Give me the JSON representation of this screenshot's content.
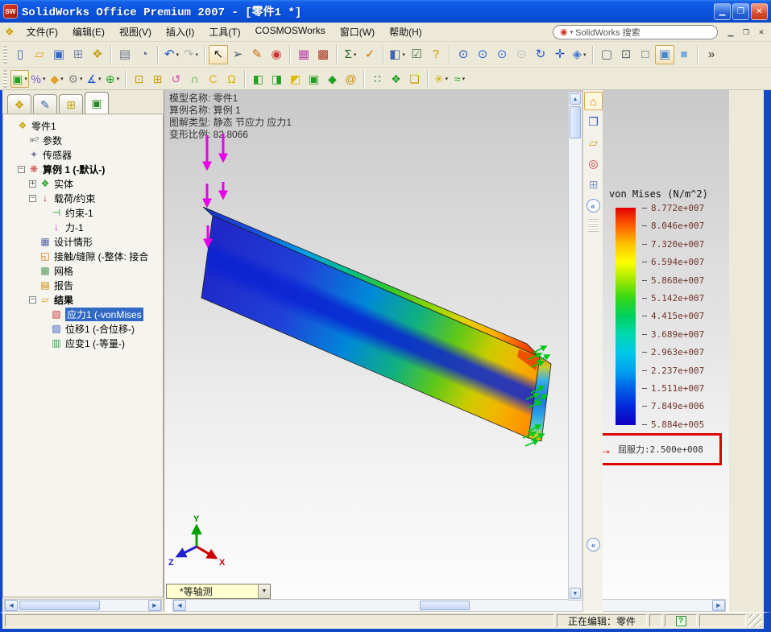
{
  "window": {
    "title": "SolidWorks Office Premium 2007 - [零件1 *]",
    "app_icon": "SW",
    "controls": [
      {
        "name": "minimize-button",
        "glyph": "▁"
      },
      {
        "name": "maximize-button",
        "glyph": "❐"
      },
      {
        "name": "close-button",
        "glyph": "✕",
        "close": true
      }
    ]
  },
  "menu": {
    "doc_icon": "❖",
    "items": [
      {
        "id": "file",
        "label": "文件(F)"
      },
      {
        "id": "edit",
        "label": "编辑(E)"
      },
      {
        "id": "view",
        "label": "视图(V)"
      },
      {
        "id": "insert",
        "label": "插入(I)"
      },
      {
        "id": "tools",
        "label": "工具(T)"
      },
      {
        "id": "cosmosworks",
        "label": "COSMOSWorks"
      },
      {
        "id": "window",
        "label": "窗口(W)"
      },
      {
        "id": "help",
        "label": "帮助(H)"
      }
    ],
    "search_placeholder": "SolidWorks 搜索",
    "mdi": [
      {
        "name": "mdi-minimize-button",
        "glyph": "▁"
      },
      {
        "name": "mdi-restore-button",
        "glyph": "❐"
      },
      {
        "name": "mdi-close-button",
        "glyph": "✕"
      }
    ]
  },
  "toolbar_main": [
    {
      "name": "new-document-button",
      "glyph": "▯",
      "color": "#3a66c8"
    },
    {
      "name": "open-document-button",
      "glyph": "▱",
      "color": "#e0a000"
    },
    {
      "name": "save-button",
      "glyph": "▣",
      "color": "#3a66c8"
    },
    {
      "name": "make-drawing-button",
      "glyph": "⊞",
      "color": "#7788aa"
    },
    {
      "name": "make-assembly-button",
      "glyph": "❖",
      "color": "#c8a020"
    },
    {
      "type": "sep"
    },
    {
      "name": "print-button",
      "glyph": "▤",
      "color": "#667788"
    },
    {
      "name": "print-preview-button",
      "glyph": "◔",
      "color": "#556688"
    },
    {
      "type": "sep"
    },
    {
      "name": "undo-button",
      "glyph": "↶",
      "color": "#2255cc",
      "dropdown": true
    },
    {
      "name": "redo-button",
      "glyph": "↷",
      "color": "#aaaaaa",
      "dropdown": true,
      "disabled": true
    },
    {
      "type": "sep"
    },
    {
      "name": "select-tool-button",
      "glyph": "↖",
      "color": "#222222",
      "pressed": true
    },
    {
      "name": "select-other-button",
      "glyph": "➢",
      "color": "#445566"
    },
    {
      "name": "sketch-button",
      "glyph": "✎",
      "color": "#cc6600"
    },
    {
      "name": "display-lights-button",
      "glyph": "◉",
      "color": "#cc3333"
    },
    {
      "type": "sep"
    },
    {
      "name": "color-swatches-button",
      "glyph": "▦",
      "color": "#bb44aa"
    },
    {
      "name": "texture-button",
      "glyph": "▩",
      "color": "#aa3322"
    },
    {
      "type": "sep"
    },
    {
      "name": "measure-button",
      "glyph": "Σ",
      "color": "#226622",
      "dropdown": true
    },
    {
      "name": "check-button",
      "glyph": "✓",
      "color": "#cc7700"
    },
    {
      "type": "sep"
    },
    {
      "name": "task-pane-button",
      "glyph": "◧",
      "color": "#4466aa",
      "dropdown": true
    },
    {
      "name": "options-list-button",
      "glyph": "☑",
      "color": "#447744"
    },
    {
      "name": "help-button",
      "glyph": "?",
      "color": "#cc9900"
    },
    {
      "type": "sep"
    },
    {
      "name": "zoom-to-fit-button",
      "glyph": "⊙",
      "color": "#2255cc"
    },
    {
      "name": "zoom-to-area-button",
      "glyph": "⊙",
      "color": "#2266dd"
    },
    {
      "name": "zoom-in-out-button",
      "glyph": "⊙",
      "color": "#3377dd"
    },
    {
      "name": "zoom-to-selection-button",
      "glyph": "⊙",
      "color": "#bbbbbb",
      "disabled": true
    },
    {
      "name": "rotate-view-button",
      "glyph": "↻",
      "color": "#2255cc"
    },
    {
      "name": "pan-button",
      "glyph": "✛",
      "color": "#2255cc"
    },
    {
      "name": "standard-views-button",
      "glyph": "◈",
      "color": "#4477cc",
      "dropdown": true
    },
    {
      "type": "sep"
    },
    {
      "name": "wireframe-button",
      "glyph": "▢",
      "color": "#556677"
    },
    {
      "name": "hidden-lines-visible-button",
      "glyph": "⊡",
      "color": "#556677"
    },
    {
      "name": "hidden-lines-removed-button",
      "glyph": "□",
      "color": "#556677"
    },
    {
      "name": "shaded-with-edges-button",
      "glyph": "▣",
      "color": "#4488cc",
      "pressed": true
    },
    {
      "name": "shaded-button",
      "glyph": "■",
      "color": "#77aadd"
    },
    {
      "type": "sep"
    },
    {
      "name": "toolbar-overflow-button",
      "glyph": "»",
      "color": "#333333"
    }
  ],
  "toolbar_cosmos": [
    {
      "name": "study-button",
      "glyph": "▣",
      "color": "#22a022",
      "dropdown": true,
      "framed": true
    },
    {
      "name": "apply-material-button",
      "glyph": "%",
      "color": "#7755cc",
      "dropdown": true
    },
    {
      "name": "restraints-button",
      "glyph": "◆",
      "color": "#e0a020",
      "dropdown": true
    },
    {
      "name": "loads-button",
      "glyph": "⚙",
      "color": "#888888",
      "dropdown": true
    },
    {
      "name": "mesh-control-button",
      "glyph": "∡",
      "color": "#2255cc",
      "dropdown": true
    },
    {
      "name": "mesh-button",
      "glyph": "⊕",
      "color": "#22a022",
      "dropdown": true
    },
    {
      "type": "sep"
    },
    {
      "name": "run-analysis-button",
      "glyph": "⊡",
      "color": "#c8a000"
    },
    {
      "name": "design-check-button",
      "glyph": "⊞",
      "color": "#c8a000"
    },
    {
      "name": "iso-clipping-button",
      "glyph": "↺",
      "color": "#cc55aa"
    },
    {
      "name": "section-clipping-button",
      "glyph": "∩",
      "color": "#22a022"
    },
    {
      "name": "clipping-c-button",
      "glyph": "C",
      "color": "#e0b000"
    },
    {
      "name": "alert-bell-button",
      "glyph": "Ω",
      "color": "#e0b000"
    },
    {
      "type": "sep"
    },
    {
      "name": "stress-plot-button",
      "glyph": "◧",
      "color": "#22a022"
    },
    {
      "name": "displacement-plot-button",
      "glyph": "◨",
      "color": "#22a022"
    },
    {
      "name": "strain-plot-button",
      "glyph": "◩",
      "color": "#ddbb00"
    },
    {
      "name": "deformation-plot-button",
      "glyph": "▣",
      "color": "#22a022"
    },
    {
      "name": "compare-results-button",
      "glyph": "◆",
      "color": "#22a022"
    },
    {
      "name": "report-button",
      "glyph": "@",
      "color": "#cc8800"
    },
    {
      "type": "sep"
    },
    {
      "name": "design-scenario-button",
      "glyph": "∷",
      "color": "#227722"
    },
    {
      "name": "optimization-button",
      "glyph": "❖",
      "color": "#22a022"
    },
    {
      "name": "tile-plots-button",
      "glyph": "❏",
      "color": "#c8a000"
    },
    {
      "type": "sep"
    },
    {
      "name": "probe-button",
      "glyph": "✳",
      "color": "#ddaa00",
      "dropdown": true
    },
    {
      "name": "trend-tracker-button",
      "glyph": "≈",
      "color": "#22a022",
      "dropdown": true
    }
  ],
  "left_panel": {
    "tabs": [
      {
        "name": "featuremanager-tab",
        "glyph": "❖",
        "color": "#c8a000"
      },
      {
        "name": "propertymanager-tab",
        "glyph": "✎",
        "color": "#3366aa"
      },
      {
        "name": "configurationmanager-tab",
        "glyph": "⊞",
        "color": "#c8a000"
      },
      {
        "name": "cosmosworks-tab",
        "glyph": "▣",
        "color": "#2a8a2a",
        "active": true
      }
    ],
    "tree": [
      {
        "label": "零件1",
        "level": 0,
        "icon": "part-icon",
        "glyph": "❖",
        "color": "#c8a000"
      },
      {
        "label": "参数",
        "level": 1,
        "icon": "parameters-icon",
        "glyph": "a=?",
        "color": "#666666",
        "small": true
      },
      {
        "label": "传感器",
        "level": 1,
        "icon": "sensors-icon",
        "glyph": "✦",
        "color": "#7777aa"
      },
      {
        "label": "算例 1 (-默认-)",
        "level": 1,
        "icon": "study-icon",
        "glyph": "❋",
        "color": "#cc4444",
        "bold": true,
        "expander": "minus"
      },
      {
        "label": "实体",
        "level": 2,
        "icon": "solids-icon",
        "glyph": "❖",
        "color": "#22a022",
        "expander": "plus"
      },
      {
        "label": "载荷/约束",
        "level": 2,
        "icon": "loads-restraints-icon",
        "glyph": "↓",
        "color": "#cc2222",
        "expander": "minus"
      },
      {
        "label": "约束-1",
        "level": 3,
        "icon": "restraint-icon",
        "glyph": "⊣",
        "color": "#22a022"
      },
      {
        "label": "力-1",
        "level": 3,
        "icon": "force-icon",
        "glyph": "↓",
        "color": "#cc22cc"
      },
      {
        "label": "设计情形",
        "level": 2,
        "icon": "design-scenario-icon",
        "glyph": "▦",
        "color": "#5566aa"
      },
      {
        "label": "接触/缝隙 (-整体: 接合",
        "level": 2,
        "icon": "contact-gap-icon",
        "glyph": "◱",
        "color": "#cc6600"
      },
      {
        "label": "网格",
        "level": 2,
        "icon": "mesh-icon",
        "glyph": "▩",
        "color": "#559955"
      },
      {
        "label": "报告",
        "level": 2,
        "icon": "report-icon",
        "glyph": "▤",
        "color": "#cc8800"
      },
      {
        "label": "结果",
        "level": 2,
        "icon": "results-folder-icon",
        "glyph": "▱",
        "color": "#e0a000",
        "bold": true,
        "expander": "minus"
      },
      {
        "label": "应力1 (-vonMises",
        "level": 3,
        "icon": "stress-result-icon",
        "glyph": "▧",
        "color": "#cc3333",
        "selected": true
      },
      {
        "label": "位移1 (-合位移-)",
        "level": 3,
        "icon": "displacement-result-icon",
        "glyph": "▨",
        "color": "#3355cc"
      },
      {
        "label": "应变1 (-等量-)",
        "level": 3,
        "icon": "strain-result-icon",
        "glyph": "▥",
        "color": "#33aa55"
      }
    ]
  },
  "viewport": {
    "annotation_lines": [
      "模型名称: 零件1",
      "算例名称: 算例 1",
      "图解类型: 静态 节应力 应力1",
      "变形比例: 82.8066"
    ],
    "legend": {
      "title": "von Mises (N/m^2)",
      "values": [
        "8.772e+007",
        "8.046e+007",
        "7.320e+007",
        "6.594e+007",
        "5.868e+007",
        "5.142e+007",
        "4.415e+007",
        "3.689e+007",
        "2.963e+007",
        "2.237e+007",
        "1.511e+007",
        "7.849e+006",
        "5.884e+005"
      ],
      "bar_gradient": [
        "#e00000",
        "#ff6000",
        "#ffc000",
        "#ffff00",
        "#a0e800",
        "#30d818",
        "#00d060",
        "#00d8b0",
        "#00c8e8",
        "#00a0f0",
        "#0060e8",
        "#0028d8",
        "#1000c0"
      ],
      "yield_label": "屈服力:2.500e+008",
      "yield_arrow": "→"
    },
    "triad": {
      "x": "X",
      "y": "Y",
      "z": "Z"
    },
    "view_selector": "*等轴测"
  },
  "taskpane": {
    "tabs": [
      {
        "name": "solidworks-resources-tab",
        "glyph": "⌂",
        "color": "#cc7700",
        "active": true
      },
      {
        "name": "design-library-tab",
        "glyph": "❒",
        "color": "#3355bb"
      },
      {
        "name": "file-explorer-tab",
        "glyph": "▱",
        "color": "#c8a000"
      },
      {
        "name": "search-tab",
        "glyph": "◎",
        "color": "#cc3333"
      },
      {
        "name": "view-palette-tab",
        "glyph": "⊞",
        "color": "#8899cc"
      }
    ],
    "collapse_glyph": "«"
  },
  "status_bar": {
    "editing": "正在编辑：零件",
    "help_glyph": "?"
  },
  "colors": {
    "titlebar_blue": "#0a54e0",
    "window_border_blue": "#1048c8",
    "toolbar_bg": "#ece9d8",
    "selection_blue": "#316ac5",
    "force_arrow_magenta": "#e800e8",
    "restraint_green": "#00c818",
    "yield_box_red": "#dd0000",
    "legend_text": "#703428",
    "view_combo_bg": "#ffffcf"
  }
}
